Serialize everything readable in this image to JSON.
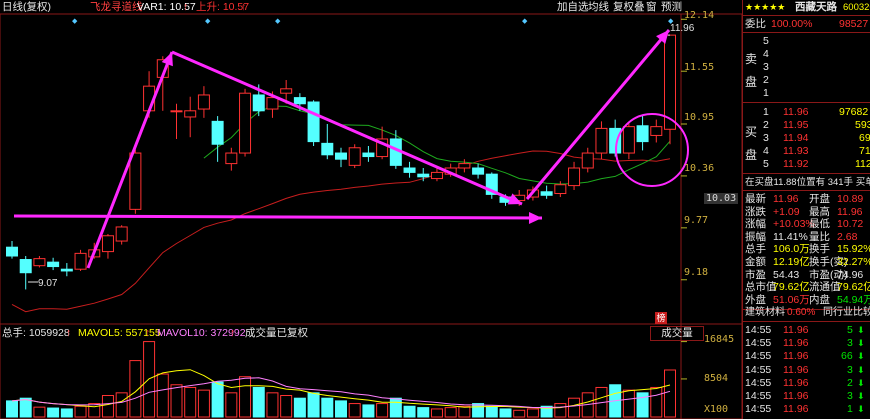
{
  "header": {
    "period_label": "日线(复权)",
    "indicator_name": "飞龙寻道线",
    "var1_label": "VAR1: 10.57",
    "var1_arrow": "↑",
    "shangping_label": "上升: 10.57",
    "shangping_arrow": "↑"
  },
  "toolbar": {
    "add_self": "加自选",
    "ma": "均线",
    "fuquan": "复权",
    "overlay": "叠",
    "window": "窗",
    "forecast": "预测"
  },
  "price_axis": [
    "12.14",
    "11.55",
    "10.95",
    "10.36",
    "10.03",
    "9.77",
    "9.18"
  ],
  "price_annotations": {
    "high": "11.96",
    "low": "9.07"
  },
  "volume_header": {
    "total_label": "总手: 1059928",
    "total_arrow": "↑",
    "mavol5": "MAVOL5: 557155",
    "mavol5_arrow": "↑",
    "mavol10": "MAVOL10: 372992",
    "mavol10_arrow": "↑",
    "mode": "成交量已复权"
  },
  "volume_axis": [
    "16845",
    "8504",
    "X100"
  ],
  "volume_tab": "成交量",
  "volume_badge": "榜",
  "colors": {
    "up": "#ff3232",
    "down": "#54ffff",
    "ma_red": "#c81e1e",
    "ma_green": "#1eaa1e",
    "drawing": "#ff28ff",
    "axis": "#b4b428"
  },
  "stock": {
    "name": "西藏天路",
    "code": "600326",
    "stars": "★★★★★"
  },
  "order_book": {
    "weibi_label": "委比",
    "weibi_value": "100.00%",
    "weicha_value": "98527",
    "sell_side_label": [
      "卖",
      "盘"
    ],
    "buy_side_label": [
      "买",
      "盘"
    ],
    "sell": [
      {
        "level": "5",
        "price": "",
        "vol": "",
        "mark": ""
      },
      {
        "level": "4",
        "price": "",
        "vol": "",
        "mark": ""
      },
      {
        "level": "3",
        "price": "",
        "vol": "",
        "mark": ""
      },
      {
        "level": "2",
        "price": "",
        "vol": "",
        "mark": ""
      },
      {
        "level": "1",
        "price": "",
        "vol": "",
        "mark": ""
      }
    ],
    "buy": [
      {
        "level": "1",
        "price": "11.96",
        "vol": "97682"
      },
      {
        "level": "2",
        "price": "11.95",
        "vol": "593"
      },
      {
        "level": "3",
        "price": "11.94",
        "vol": "69"
      },
      {
        "level": "4",
        "price": "11.93",
        "vol": "71"
      },
      {
        "level": "5",
        "price": "11.92",
        "vol": "112"
      }
    ],
    "status_line": "在买盘11.88位置有 341手 买单"
  },
  "quote": [
    {
      "l1": "最新",
      "v1": "11.96",
      "c1": "red",
      "l2": "开盘",
      "v2": "10.89",
      "c2": "red"
    },
    {
      "l1": "涨跌",
      "v1": "+1.09",
      "c1": "red",
      "l2": "最高",
      "v2": "11.96",
      "c2": "red"
    },
    {
      "l1": "涨幅",
      "v1": "+10.03%",
      "c1": "red",
      "l2": "最低",
      "v2": "10.72",
      "c2": "red"
    },
    {
      "l1": "振幅",
      "v1": "11.41%",
      "c1": "wht",
      "l2": "量比",
      "v2": "2.68",
      "c2": "red"
    },
    {
      "l1": "总手",
      "v1": "106.0万",
      "c1": "yel",
      "l2": "换手",
      "v2": "15.92%",
      "c2": "yel"
    },
    {
      "l1": "金额",
      "v1": "12.19亿",
      "c1": "yel",
      "l2": "换手(实)",
      "v2": "32.27%",
      "c2": "yel"
    },
    {
      "l1": "市盈",
      "v1": "54.43",
      "c1": "wht",
      "l2": "市盈(动)",
      "v2": "74.96",
      "c2": "wht"
    },
    {
      "l1": "总市值",
      "v1": "79.62亿",
      "c1": "yel",
      "l2": "流通值",
      "v2": "79.62亿",
      "c2": "yel"
    },
    {
      "l1": "外盘",
      "v1": "51.06万",
      "c1": "red",
      "l2": "内盘",
      "v2": "54.94万",
      "c2": "grn"
    }
  ],
  "tabs": {
    "sector": "建筑材料",
    "sector_change": "0.60%",
    "compare": "同行业比较"
  },
  "ticks": [
    {
      "time": "14:55",
      "price": "11.96",
      "vol": "5",
      "dir": "down"
    },
    {
      "time": "14:55",
      "price": "11.96",
      "vol": "3",
      "dir": "down"
    },
    {
      "time": "14:55",
      "price": "11.96",
      "vol": "66",
      "dir": "down"
    },
    {
      "time": "14:55",
      "price": "11.96",
      "vol": "3",
      "dir": "down"
    },
    {
      "time": "14:55",
      "price": "11.96",
      "vol": "2",
      "dir": "down"
    },
    {
      "time": "14:55",
      "price": "11.96",
      "vol": "3",
      "dir": "down"
    },
    {
      "time": "14:55",
      "price": "11.96",
      "vol": "1",
      "dir": "down"
    }
  ],
  "candles": [
    {
      "o": 9.55,
      "c": 9.45,
      "h": 9.62,
      "l": 9.42
    },
    {
      "o": 9.41,
      "c": 9.26,
      "h": 9.45,
      "l": 9.07
    },
    {
      "o": 9.34,
      "c": 9.42,
      "h": 9.45,
      "l": 9.32
    },
    {
      "o": 9.38,
      "c": 9.33,
      "h": 9.43,
      "l": 9.29
    },
    {
      "o": 9.3,
      "c": 9.28,
      "h": 9.37,
      "l": 9.22
    },
    {
      "o": 9.3,
      "c": 9.48,
      "h": 9.52,
      "l": 9.28
    },
    {
      "o": 9.44,
      "c": 9.52,
      "h": 9.6,
      "l": 9.42
    },
    {
      "o": 9.5,
      "c": 9.68,
      "h": 9.7,
      "l": 9.42
    },
    {
      "o": 9.62,
      "c": 9.78,
      "h": 9.8,
      "l": 9.58
    },
    {
      "o": 9.98,
      "c": 10.62,
      "h": 10.66,
      "l": 9.93
    },
    {
      "o": 11.1,
      "c": 11.38,
      "h": 11.55,
      "l": 11.02
    },
    {
      "o": 11.48,
      "c": 11.68,
      "h": 11.72,
      "l": 11.1
    },
    {
      "o": 11.1,
      "c": 11.1,
      "h": 11.18,
      "l": 10.78
    },
    {
      "o": 11.03,
      "c": 11.1,
      "h": 11.26,
      "l": 10.8
    },
    {
      "o": 11.12,
      "c": 11.28,
      "h": 11.38,
      "l": 11.02
    },
    {
      "o": 10.98,
      "c": 10.72,
      "h": 11.04,
      "l": 10.52
    },
    {
      "o": 10.5,
      "c": 10.62,
      "h": 10.68,
      "l": 10.42
    },
    {
      "o": 10.62,
      "c": 11.3,
      "h": 11.35,
      "l": 10.58
    },
    {
      "o": 11.28,
      "c": 11.1,
      "h": 11.4,
      "l": 11.04
    },
    {
      "o": 11.12,
      "c": 11.25,
      "h": 11.32,
      "l": 11.02
    },
    {
      "o": 11.3,
      "c": 11.35,
      "h": 11.45,
      "l": 11.18
    },
    {
      "o": 11.25,
      "c": 11.18,
      "h": 11.3,
      "l": 11.1
    },
    {
      "o": 11.2,
      "c": 10.75,
      "h": 11.22,
      "l": 10.7
    },
    {
      "o": 10.73,
      "c": 10.6,
      "h": 10.95,
      "l": 10.55
    },
    {
      "o": 10.62,
      "c": 10.55,
      "h": 10.68,
      "l": 10.46
    },
    {
      "o": 10.48,
      "c": 10.68,
      "h": 10.72,
      "l": 10.45
    },
    {
      "o": 10.62,
      "c": 10.58,
      "h": 10.7,
      "l": 10.52
    },
    {
      "o": 10.58,
      "c": 10.78,
      "h": 10.92,
      "l": 10.55
    },
    {
      "o": 10.78,
      "c": 10.48,
      "h": 10.88,
      "l": 10.44
    },
    {
      "o": 10.45,
      "c": 10.4,
      "h": 10.52,
      "l": 10.34
    },
    {
      "o": 10.38,
      "c": 10.35,
      "h": 10.45,
      "l": 10.3
    },
    {
      "o": 10.33,
      "c": 10.4,
      "h": 10.46,
      "l": 10.3
    },
    {
      "o": 10.38,
      "c": 10.45,
      "h": 10.5,
      "l": 10.35
    },
    {
      "o": 10.45,
      "c": 10.5,
      "h": 10.55,
      "l": 10.4
    },
    {
      "o": 10.45,
      "c": 10.38,
      "h": 10.5,
      "l": 10.33
    },
    {
      "o": 10.38,
      "c": 10.15,
      "h": 10.4,
      "l": 10.1
    },
    {
      "o": 10.12,
      "c": 10.06,
      "h": 10.15,
      "l": 10.02
    },
    {
      "o": 10.08,
      "c": 10.14,
      "h": 10.2,
      "l": 10.02
    },
    {
      "o": 10.12,
      "c": 10.2,
      "h": 10.24,
      "l": 10.08
    },
    {
      "o": 10.18,
      "c": 10.14,
      "h": 10.25,
      "l": 10.1
    },
    {
      "o": 10.16,
      "c": 10.26,
      "h": 10.3,
      "l": 10.12
    },
    {
      "o": 10.25,
      "c": 10.45,
      "h": 10.52,
      "l": 10.2
    },
    {
      "o": 10.45,
      "c": 10.62,
      "h": 10.68,
      "l": 10.4
    },
    {
      "o": 10.62,
      "c": 10.9,
      "h": 10.98,
      "l": 10.55
    },
    {
      "o": 10.9,
      "c": 10.62,
      "h": 11.0,
      "l": 10.58
    },
    {
      "o": 10.62,
      "c": 10.92,
      "h": 10.96,
      "l": 10.55
    },
    {
      "o": 10.93,
      "c": 10.75,
      "h": 11.05,
      "l": 10.65
    },
    {
      "o": 10.82,
      "c": 10.92,
      "h": 11.0,
      "l": 10.74
    },
    {
      "o": 10.89,
      "c": 11.96,
      "h": 11.96,
      "l": 10.72
    }
  ],
  "volumes": [
    3600,
    4200,
    2200,
    2000,
    1800,
    2400,
    3000,
    4800,
    5400,
    12600,
    16845,
    9600,
    7200,
    6600,
    6000,
    7800,
    5400,
    9000,
    6600,
    5400,
    4800,
    4200,
    5400,
    4200,
    3600,
    3000,
    2700,
    3000,
    4200,
    2400,
    2100,
    1800,
    2100,
    2400,
    3000,
    2400,
    1800,
    1500,
    1800,
    2400,
    3000,
    4200,
    5400,
    6600,
    7200,
    6000,
    5400,
    6600,
    10500
  ]
}
